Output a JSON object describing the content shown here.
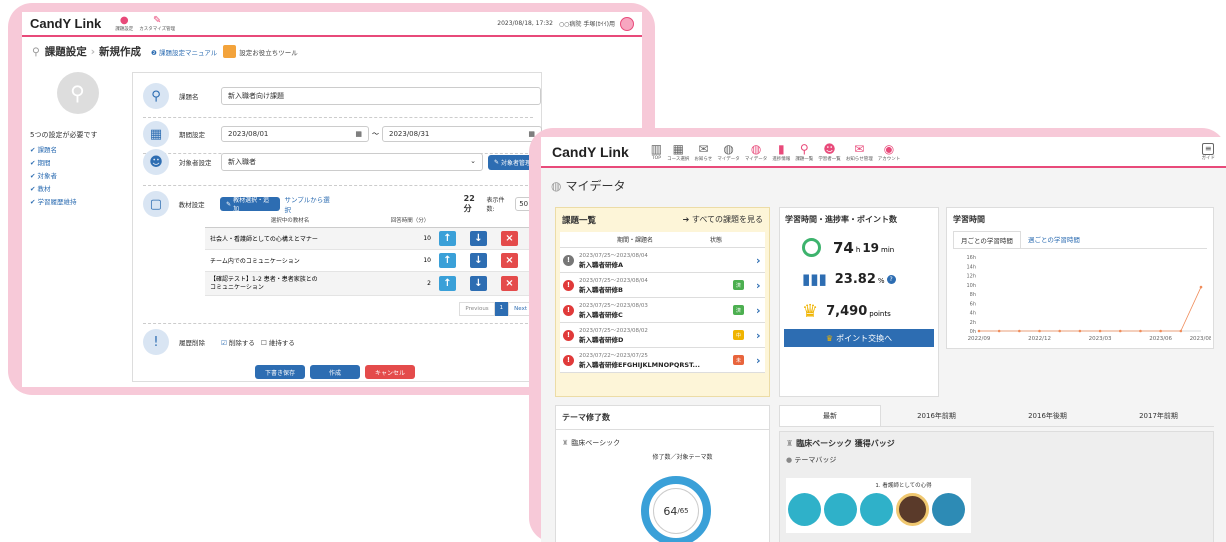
{
  "back": {
    "brand": "CandY Link",
    "nav": [
      {
        "label": "課題設定"
      },
      {
        "label": "カスタマイズ管理"
      }
    ],
    "datetime": "2023/08/18, 17:32",
    "user": "○○病院 手塚(ｶｲｲ)用",
    "breadcrumb_root": "課題設定",
    "breadcrumb_current": "新規作成",
    "manual_link": "課題設定マニュアル",
    "tool_link": "設定お役立ちツール",
    "required_text": "5つの設定が必要です",
    "checklist": [
      "課題名",
      "期間",
      "対象者",
      "教材",
      "学習履歴維持"
    ],
    "fields": {
      "name_label": "課題名",
      "name_value": "新入職者向け課題",
      "period_label": "期間設定",
      "period_start": "2023/08/01",
      "period_sep": "～",
      "period_end": "2023/08/31",
      "target_label": "対象者設定",
      "target_value": "新入職者",
      "target_manage": "対象者管理",
      "material_label": "教材設定",
      "material_add": "教材選択・追加",
      "material_sample": "サンプルから選択",
      "total": "22分",
      "per_page_label": "表示件数:",
      "per_page": "50",
      "col_name": "選択中の教材名",
      "col_time": "回答時間（分）",
      "history_label": "履歴削除",
      "history_delete": "削除する",
      "history_keep": "維持する"
    },
    "materials": [
      {
        "name": "社会人・看護師としての心構えとマナー",
        "time": "10"
      },
      {
        "name": "チーム内でのコミュニケーション",
        "time": "10"
      },
      {
        "name": "【確認テスト】1-2 患者・患者家族との\nコミュニケーション",
        "time": "2"
      }
    ],
    "pager": {
      "prev": "Previous",
      "page": "1",
      "next": "Next"
    },
    "buttons": {
      "draft": "下書き保存",
      "create": "作成",
      "cancel": "キャンセル"
    }
  },
  "front": {
    "brand": "CandY Link",
    "nav": [
      "TOP",
      "コース選択",
      "お知らせ",
      "マイデータ",
      "マイデータ",
      "進捗情報",
      "課題一覧",
      "学習者一覧",
      "お知らせ管理",
      "アカウント"
    ],
    "guide": "ガイド",
    "page_title": "マイデータ",
    "courses_title": "課題一覧",
    "courses_all": "すべての課題を見る",
    "courses_col_name": "期間・課題名",
    "courses_col_status": "状態",
    "courses": [
      {
        "period": "2023/07/25～2023/08/04",
        "name": "新入職者研修A",
        "status": "",
        "color": "#888"
      },
      {
        "period": "2023/07/25～2023/08/04",
        "name": "新入職者研修B",
        "status": "済",
        "color": "#4caf50"
      },
      {
        "period": "2023/07/25～2023/08/03",
        "name": "新入職者研修C",
        "status": "済",
        "color": "#4caf50"
      },
      {
        "period": "2023/07/25～2023/08/02",
        "name": "新入職者研修D",
        "status": "中",
        "color": "#f0b400"
      },
      {
        "period": "2023/07/22～2023/07/25",
        "name": "新入職者研修EFGHIJKLMNOPQRST...",
        "status": "未",
        "color": "#e8643c"
      }
    ],
    "stats_title": "学習時間・進捗率・ポイント数",
    "stats": {
      "hours": "74",
      "h": "h",
      "mins": "19",
      "min": "min",
      "progress": "23.82",
      "pct": "%",
      "points": "7,490",
      "pts": "points"
    },
    "exchange": "ポイント交換へ",
    "time_title": "学習時間",
    "tabs": [
      "月ごとの学習時間",
      "週ごとの学習時間"
    ],
    "chart_data": {
      "type": "line",
      "x": [
        "2022/09",
        "2022/10",
        "2022/11",
        "2022/12",
        "2023/01",
        "2023/02",
        "2023/03",
        "2023/04",
        "2023/05",
        "2023/06",
        "2023/07",
        "2023/08"
      ],
      "values": [
        0,
        0,
        0,
        0,
        0,
        0,
        0,
        0,
        0,
        0,
        0,
        9.5
      ],
      "ylim": [
        0,
        16
      ],
      "yticks": [
        "0h",
        "2h",
        "4h",
        "6h",
        "8h",
        "10h",
        "12h",
        "14h",
        "16h"
      ],
      "xticks": [
        "2022/09",
        "2022/12",
        "2023/03",
        "2023/06",
        "2023/08"
      ],
      "color": "#f08c5a"
    },
    "theme_title": "テーマ修了数",
    "theme_sub": "臨床ベーシック",
    "theme_caption": "修了数／対象テーマ数",
    "theme_done": "64",
    "theme_total": "65",
    "year_tabs": [
      "最新",
      "2016年前期",
      "2016年後期",
      "2017年前期"
    ],
    "badge_title": "臨床ベーシック 獲得バッジ",
    "badge_sub": "テーマバッジ",
    "badge_caption": "1. 看護師としての心得"
  }
}
